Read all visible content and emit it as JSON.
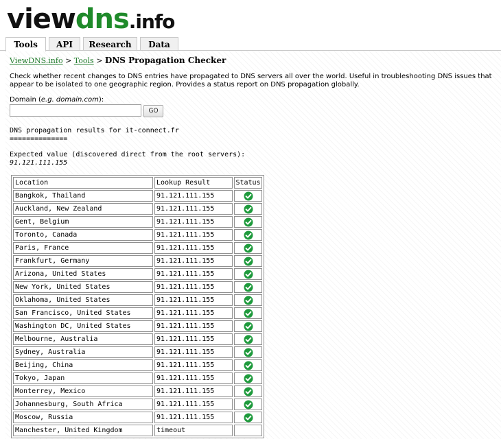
{
  "logo": {
    "part1": "view",
    "part2": "dns",
    "part3": ".info"
  },
  "tabs": [
    {
      "label": "Tools",
      "active": true
    },
    {
      "label": "API",
      "active": false
    },
    {
      "label": "Research",
      "active": false
    },
    {
      "label": "Data",
      "active": false
    }
  ],
  "breadcrumb": {
    "home": "ViewDNS.info",
    "sep1": " > ",
    "tools": "Tools",
    "sep2": " > ",
    "current": "DNS Propagation Checker"
  },
  "description": "Check whether recent changes to DNS entries have propagated to DNS servers all over the world. Useful in troubleshooting DNS issues that appear to be isolated to one geographic region. Provides a status report on DNS propagation globally.",
  "form": {
    "label_prefix": "Domain (",
    "label_example": "e.g. domain.com",
    "label_suffix": "):",
    "input_value": "",
    "go_label": "GO"
  },
  "results": {
    "title": "DNS propagation results for it-connect.fr",
    "underline": "==============",
    "expected_label": "Expected value (discovered direct from the root servers):",
    "expected_value": "91.121.111.155"
  },
  "table": {
    "headers": [
      "Location",
      "Lookup Result",
      "Status"
    ],
    "rows": [
      {
        "location": "Bangkok, Thailand",
        "result": "91.121.111.155",
        "status": "ok"
      },
      {
        "location": "Auckland, New Zealand",
        "result": "91.121.111.155",
        "status": "ok"
      },
      {
        "location": "Gent, Belgium",
        "result": "91.121.111.155",
        "status": "ok"
      },
      {
        "location": "Toronto, Canada",
        "result": "91.121.111.155",
        "status": "ok"
      },
      {
        "location": "Paris, France",
        "result": "91.121.111.155",
        "status": "ok"
      },
      {
        "location": "Frankfurt, Germany",
        "result": "91.121.111.155",
        "status": "ok"
      },
      {
        "location": "Arizona, United States",
        "result": "91.121.111.155",
        "status": "ok"
      },
      {
        "location": "New York, United States",
        "result": "91.121.111.155",
        "status": "ok"
      },
      {
        "location": "Oklahoma, United States",
        "result": "91.121.111.155",
        "status": "ok"
      },
      {
        "location": "San Francisco, United States",
        "result": "91.121.111.155",
        "status": "ok"
      },
      {
        "location": "Washington DC, United States",
        "result": "91.121.111.155",
        "status": "ok"
      },
      {
        "location": "Melbourne, Australia",
        "result": "91.121.111.155",
        "status": "ok"
      },
      {
        "location": "Sydney, Australia",
        "result": "91.121.111.155",
        "status": "ok"
      },
      {
        "location": "Beijing, China",
        "result": "91.121.111.155",
        "status": "ok"
      },
      {
        "location": "Tokyo, Japan",
        "result": "91.121.111.155",
        "status": "ok"
      },
      {
        "location": "Monterrey, Mexico",
        "result": "91.121.111.155",
        "status": "ok"
      },
      {
        "location": "Johannesburg, South Africa",
        "result": "91.121.111.155",
        "status": "ok"
      },
      {
        "location": "Moscow, Russia",
        "result": "91.121.111.155",
        "status": "ok"
      },
      {
        "location": "Manchester, United Kingdom",
        "result": "timeout",
        "status": "none"
      }
    ]
  },
  "colors": {
    "brand_green": "#1f8a2a",
    "link_green": "#1f7a2a",
    "check_green": "#1e9a3c"
  }
}
